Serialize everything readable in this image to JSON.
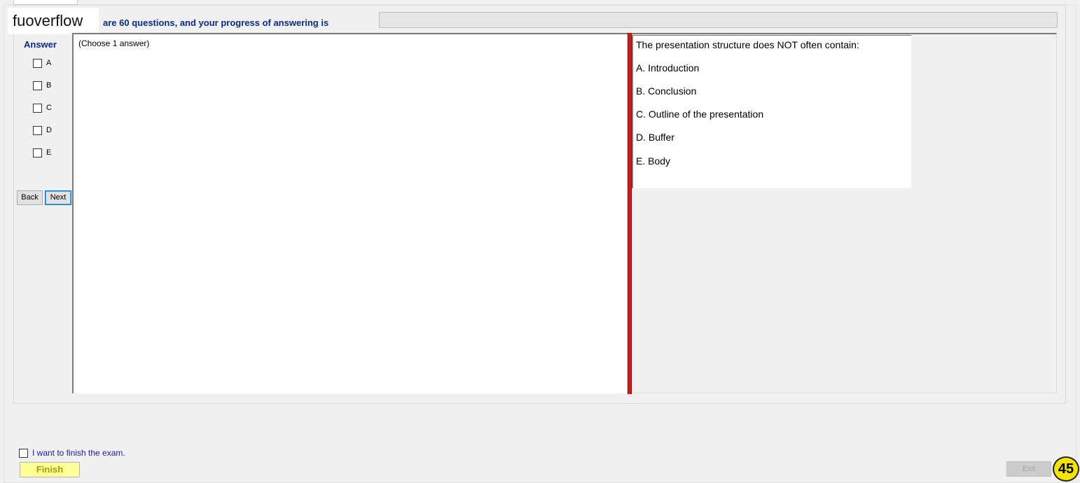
{
  "watermark": "fuoverflow",
  "header": {
    "progress_text": "are 60 questions, and your progress of answering is",
    "progress_fraction": 0
  },
  "answer_panel": {
    "title": "Answer",
    "options": [
      "A",
      "B",
      "C",
      "D",
      "E"
    ],
    "back_label": "Back",
    "next_label": "Next"
  },
  "left_pane": {
    "instruction": "(Choose 1 answer)"
  },
  "question": {
    "text": "The presentation structure does NOT often contain:",
    "options": [
      "A.  Introduction",
      "B.  Conclusion",
      "C.  Outline of the presentation",
      "D.  Buffer",
      "E.  Body"
    ]
  },
  "footer": {
    "finish_checkbox_label": "I want to finish the exam.",
    "finish_label": "Finish",
    "exit_label": "Exit",
    "page_number": "45"
  },
  "colors": {
    "header_text": "#0a2a8a",
    "splitter": "#d41a1a",
    "finish_bg": "#ffff99",
    "badge_bg": "#f5e400"
  }
}
